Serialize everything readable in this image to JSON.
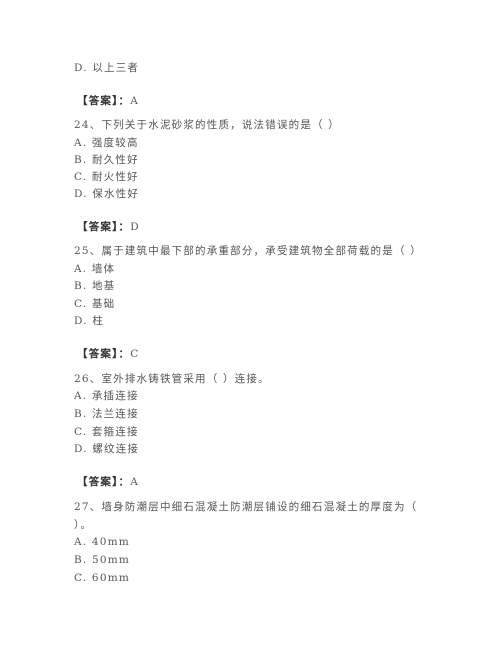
{
  "prev_question_tail": {
    "option_d": "D. 以上三者"
  },
  "answer_prefix": "【答案】：",
  "items": [
    {
      "answer": "A"
    },
    {
      "question": "24、下列关于水泥砂浆的性质，说法错误的是（     ）",
      "options": [
        "A. 强度较高",
        "B. 耐久性好",
        "C. 耐火性好",
        "D. 保水性好"
      ],
      "answer": "D"
    },
    {
      "question": "25、属于建筑中最下部的承重部分，承受建筑物全部荷载的是（     ）",
      "options": [
        "A. 墙体",
        "B. 地基",
        "C. 基础",
        "D. 柱"
      ],
      "answer": "C"
    },
    {
      "question": "26、室外排水铸铁管采用（     ）连接。",
      "options": [
        "A. 承插连接",
        "B. 法兰连接",
        "C. 套箍连接",
        "D. 螺纹连接"
      ],
      "answer": "A"
    },
    {
      "question_line1": "27、墙身防潮层中细石混凝土防潮层铺设的细石混凝土的厚度为（",
      "question_line2": "）。",
      "options": [
        "A. 40mm",
        "B. 50mm",
        "C. 60mm"
      ]
    }
  ]
}
